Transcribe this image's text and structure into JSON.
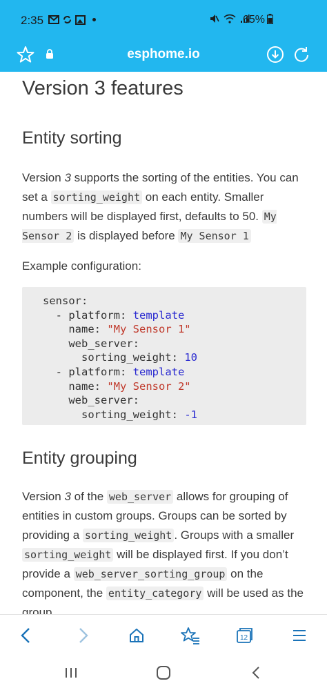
{
  "status_bar": {
    "time": "2:35",
    "battery_pct": "65%"
  },
  "browser": {
    "domain": "esphome.io",
    "tabs_count": "12"
  },
  "content": {
    "page_title": "Version 3 features",
    "section1": {
      "heading": "Entity sorting",
      "p1_a": "Version ",
      "p1_em": "3",
      "p1_b": " supports the sorting of the entities. You can set a ",
      "p1_code1": "sorting_weight",
      "p1_c": " on each entity. Smaller numbers will be displayed first, defaults to 50. ",
      "p1_code2": "My Sensor 2",
      "p1_d": " is displayed before ",
      "p1_code3": "My Sensor 1",
      "example_label": "Example configuration:"
    },
    "code": {
      "l1": "sensor:",
      "l2_dash": "  - platform: ",
      "l2_val": "template",
      "l3_key": "    name: ",
      "l3_val": "\"My Sensor 1\"",
      "l4": "    web_server:",
      "l5_key": "      sorting_weight: ",
      "l5_val": "10",
      "l6_dash": "  - platform: ",
      "l6_val": "template",
      "l7_key": "    name: ",
      "l7_val": "\"My Sensor 2\"",
      "l8": "    web_server:",
      "l9_key": "      sorting_weight: ",
      "l9_val": "-1"
    },
    "section2": {
      "heading": "Entity grouping",
      "p_a": "Version ",
      "p_em": "3",
      "p_b": " of the ",
      "p_code1": "web_server",
      "p_c": " allows for grouping of entities in custom groups. Groups can be sorted by providing a ",
      "p_code2": "sorting_weight",
      "p_d": ". Groups with a smaller ",
      "p_code3": "sorting_weight",
      "p_e": " will be displayed first. If you don’t provide a ",
      "p_code4": "web_server_sorting_group",
      "p_f": " on the component, the ",
      "p_code5": "entity_category",
      "p_g": " will be used as the group."
    }
  },
  "icons": {
    "star": "star-icon",
    "lock": "lock-icon",
    "download": "download-icon",
    "reload": "reload-icon",
    "back": "back-icon",
    "forward": "forward-icon",
    "home": "home-icon",
    "bookmarks": "bookmark-star-icon",
    "tabs": "tabs-icon",
    "menu": "menu-icon"
  },
  "colors": {
    "topbar": "#22b7ef",
    "nav_icon": "#1a73b8",
    "code_bg": "#ececec"
  }
}
